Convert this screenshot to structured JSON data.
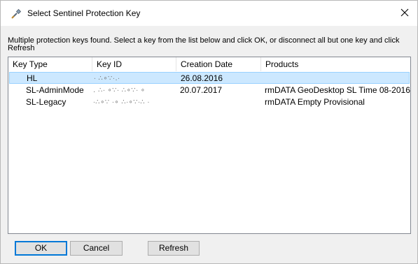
{
  "window": {
    "title": "Select Sentinel Protection Key",
    "close_glyph": "✕"
  },
  "instruction": "Multiple protection keys found. Select a key from the list below and click OK, or disconnect all but one key and click Refresh",
  "list": {
    "columns": [
      "Key Type",
      "Key ID",
      "Creation Date",
      "Products"
    ],
    "rows": [
      {
        "key_type": "HL",
        "key_id": "∙ ∴∘∵∙․∙",
        "creation_date": "26.08.2016",
        "products": "",
        "selected": true
      },
      {
        "key_type": "SL-AdminMode",
        "key_id": "․ ∴∙ ∘∵∙ ∴∘∵∙ ∘",
        "creation_date": "20.07.2017",
        "products": "rmDATA GeoDesktop SL Time 08-2016",
        "selected": false
      },
      {
        "key_type": "SL-Legacy",
        "key_id": "∙∴∘∵ ∙∘ ∴∙∘∵∙∴ ∙",
        "creation_date": "",
        "products": "rmDATA Empty Provisional",
        "selected": false
      }
    ]
  },
  "buttons": {
    "ok": "OK",
    "cancel": "Cancel",
    "refresh": "Refresh"
  },
  "icons": {
    "title_icon": "key-icon",
    "close_icon": "close-icon"
  },
  "colors": {
    "selection_bg": "#cce8ff",
    "selection_border": "#99d1ff",
    "default_button_border": "#0078d7"
  }
}
